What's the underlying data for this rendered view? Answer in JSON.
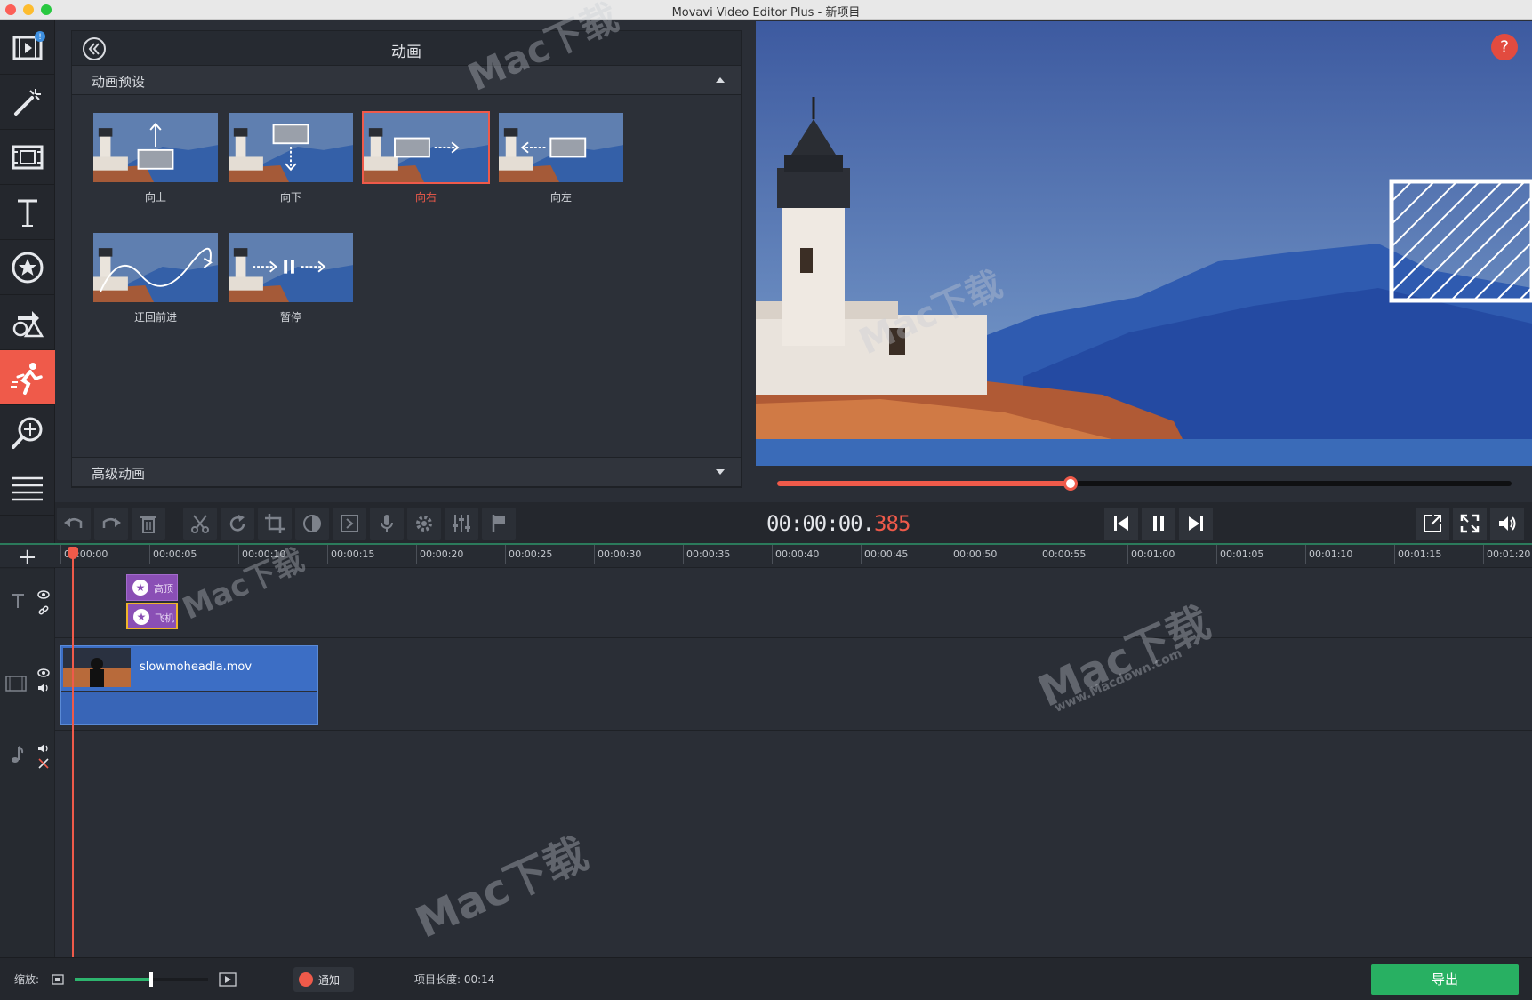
{
  "window": {
    "title": "Movavi Video Editor Plus - 新项目"
  },
  "panel": {
    "title": "动画",
    "section_presets": "动画预设",
    "section_advanced": "高级动画",
    "presets": [
      {
        "label": "向上",
        "selected": false,
        "arrow": "arrow-up"
      },
      {
        "label": "向下",
        "selected": false,
        "arrow": "arrow-down"
      },
      {
        "label": "向右",
        "selected": true,
        "arrow": "arrow-right"
      },
      {
        "label": "向左",
        "selected": false,
        "arrow": "arrow-left"
      },
      {
        "label": "迂回前进",
        "selected": false,
        "arrow": "wavy-arrow"
      },
      {
        "label": "暂停",
        "selected": false,
        "arrow": "pause-arrows"
      }
    ]
  },
  "sidebar": {
    "items": [
      {
        "icon": "import-media-icon",
        "badge": "!"
      },
      {
        "icon": "magic-wand-icon"
      },
      {
        "icon": "transitions-icon"
      },
      {
        "icon": "titles-icon"
      },
      {
        "icon": "stickers-icon"
      },
      {
        "icon": "shapes-icon"
      },
      {
        "icon": "animation-icon",
        "active": true
      },
      {
        "icon": "zoom-pan-icon"
      },
      {
        "icon": "more-tools-icon"
      }
    ]
  },
  "preview": {
    "help": "?"
  },
  "player": {
    "timecode_main": "00:00:00.",
    "timecode_ms": "385",
    "progress": 0.4
  },
  "timeline": {
    "ticks": [
      "00:00:00",
      "00:00:05",
      "00:00:10",
      "00:00:15",
      "00:00:20",
      "00:00:25",
      "00:00:30",
      "00:00:35",
      "00:00:40",
      "00:00:45",
      "00:00:50",
      "00:00:55",
      "00:01:00",
      "00:01:05",
      "00:01:10",
      "00:01:15",
      "00:01:20"
    ],
    "title_clips": [
      {
        "label": "高顶"
      },
      {
        "label": "飞机"
      }
    ],
    "video_clip": {
      "label": "slowmoheadla.mov"
    }
  },
  "status": {
    "zoom_label": "缩放:",
    "zoom_level": 0.57,
    "notify": "通知",
    "project_length": "项目长度:  00:14",
    "export": "导出"
  },
  "watermarks": [
    "Mac下载",
    "www.Macdown.com"
  ],
  "colors": {
    "accent": "#ef5a4a",
    "export": "#28b062",
    "clip": "#3c6ec5",
    "title_clip": "#8a4fb5"
  }
}
